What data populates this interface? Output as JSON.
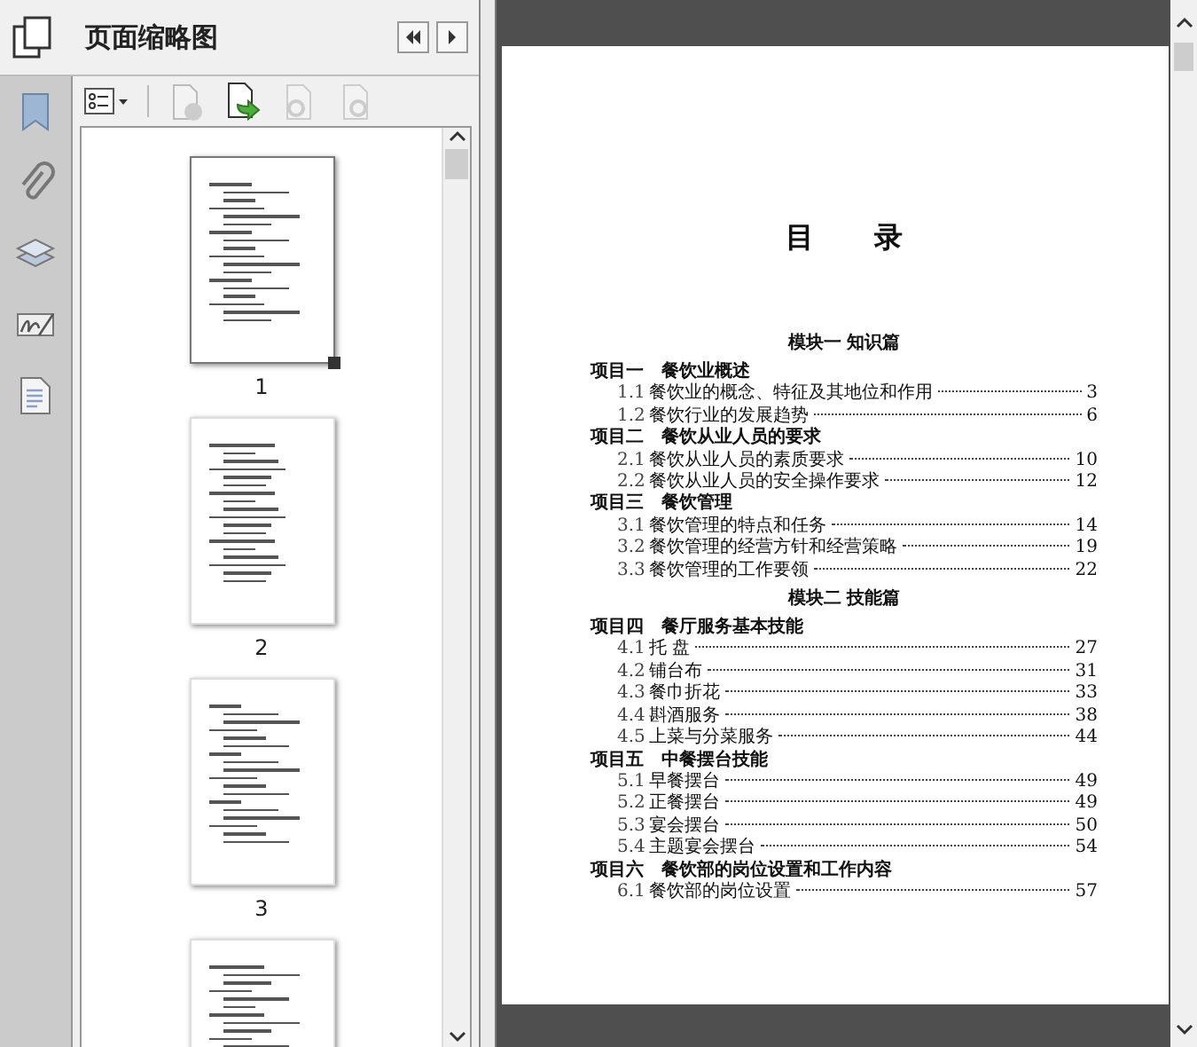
{
  "panel": {
    "title": "页面缩略图"
  },
  "thumbnails": [
    {
      "label": "1",
      "selected": true
    },
    {
      "label": "2",
      "selected": false
    },
    {
      "label": "3",
      "selected": false
    },
    {
      "selected": false
    }
  ],
  "document": {
    "heading": "目 录",
    "modules": [
      {
        "title": "模块一 知识篇",
        "projects": [
          {
            "label": "项目一",
            "title": "餐饮业概述",
            "items": [
              {
                "number": "1.1",
                "title": "餐饮业的概念、特征及其地位和作用",
                "page": "3"
              },
              {
                "number": "1.2",
                "title": "餐饮行业的发展趋势",
                "page": "6"
              }
            ]
          },
          {
            "label": "项目二",
            "title": "餐饮从业人员的要求",
            "items": [
              {
                "number": "2.1",
                "title": "餐饮从业人员的素质要求",
                "page": "10"
              },
              {
                "number": "2.2",
                "title": "餐饮从业人员的安全操作要求",
                "page": "12"
              }
            ]
          },
          {
            "label": "项目三",
            "title": "餐饮管理",
            "items": [
              {
                "number": "3.1",
                "title": "餐饮管理的特点和任务",
                "page": "14"
              },
              {
                "number": "3.2",
                "title": "餐饮管理的经营方针和经营策略",
                "page": "19"
              },
              {
                "number": "3.3",
                "title": "餐饮管理的工作要领",
                "page": "22"
              }
            ]
          }
        ]
      },
      {
        "title": "模块二 技能篇",
        "projects": [
          {
            "label": "项目四",
            "title": "餐厅服务基本技能",
            "items": [
              {
                "number": "4.1",
                "title": "托 盘",
                "page": "27"
              },
              {
                "number": "4.2",
                "title": "铺台布",
                "page": "31"
              },
              {
                "number": "4.3",
                "title": "餐巾折花",
                "page": "33"
              },
              {
                "number": "4.4",
                "title": "斟酒服务",
                "page": "38"
              },
              {
                "number": "4.5",
                "title": "上菜与分菜服务",
                "page": "44"
              }
            ]
          },
          {
            "label": "项目五",
            "title": "中餐摆台技能",
            "items": [
              {
                "number": "5.1",
                "title": "早餐摆台",
                "page": "49"
              },
              {
                "number": "5.2",
                "title": "正餐摆台",
                "page": "49"
              },
              {
                "number": "5.3",
                "title": "宴会摆台",
                "page": "50"
              },
              {
                "number": "5.4",
                "title": "主题宴会摆台",
                "page": "54"
              }
            ]
          },
          {
            "label": "项目六",
            "title": "餐饮部的岗位设置和工作内容",
            "items": [
              {
                "number": "6.1",
                "title": "餐饮部的岗位设置",
                "page": "57"
              }
            ]
          }
        ]
      }
    ]
  }
}
